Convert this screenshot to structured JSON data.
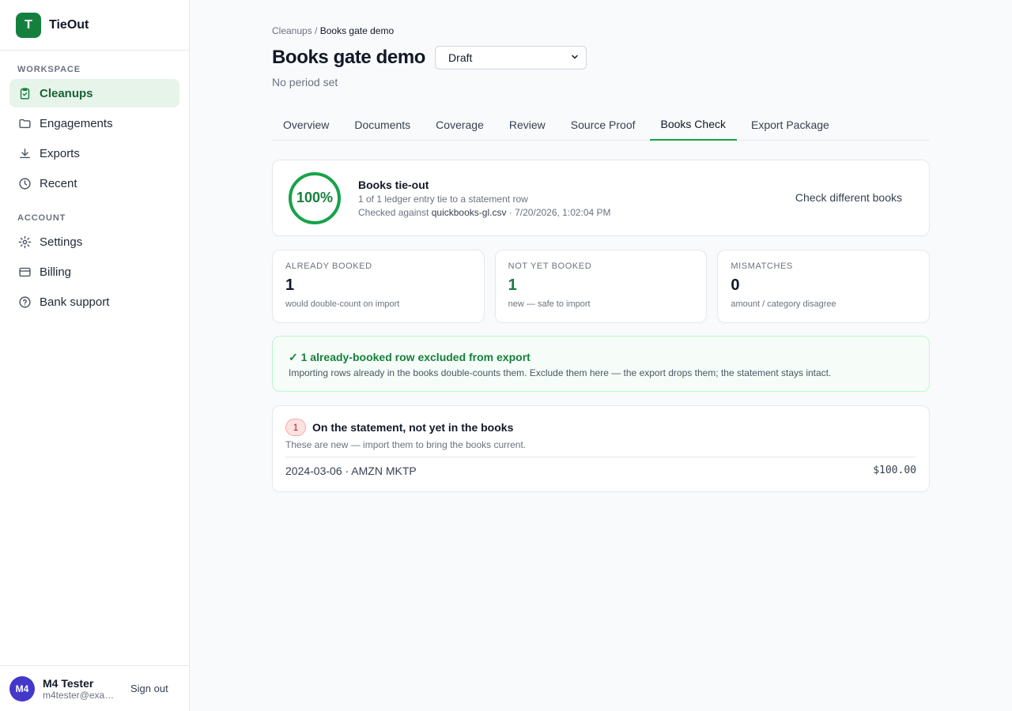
{
  "app": {
    "logo_letter": "T",
    "name": "TieOut"
  },
  "sidebar": {
    "workspace_label": "WORKSPACE",
    "account_label": "ACCOUNT",
    "workspace_items": [
      {
        "label": "Cleanups",
        "icon": "clipboard-check-icon"
      },
      {
        "label": "Engagements",
        "icon": "folder-icon"
      },
      {
        "label": "Exports",
        "icon": "download-icon"
      },
      {
        "label": "Recent",
        "icon": "clock-icon"
      }
    ],
    "account_items": [
      {
        "label": "Settings",
        "icon": "gear-icon"
      },
      {
        "label": "Billing",
        "icon": "credit-card-icon"
      },
      {
        "label": "Bank support",
        "icon": "help-circle-icon"
      }
    ]
  },
  "user": {
    "initials": "M4",
    "name": "M4 Tester",
    "email": "m4tester@example.com",
    "signout_label": "Sign out"
  },
  "breadcrumb": {
    "parent": "Cleanups",
    "separator": "/",
    "current": "Books gate demo"
  },
  "page": {
    "title": "Books gate demo",
    "status": "Draft",
    "period": "No period set"
  },
  "tabs": [
    "Overview",
    "Documents",
    "Coverage",
    "Review",
    "Source Proof",
    "Books Check",
    "Export Package"
  ],
  "active_tab": "Books Check",
  "tieout": {
    "percent": "100%",
    "title": "Books tie-out",
    "summary": "1 of 1 ledger entry tie to a statement row",
    "checked_prefix": "Checked against",
    "file": "quickbooks-gl.csv",
    "checked_suffix": "· 7/20/2026, 1:02:04 PM",
    "action_label": "Check different books"
  },
  "stats": [
    {
      "label": "ALREADY BOOKED",
      "value": "1",
      "note": "would double-count on import"
    },
    {
      "label": "NOT YET BOOKED",
      "value": "1",
      "note": "new — safe to import"
    },
    {
      "label": "MISMATCHES",
      "value": "0",
      "note": "amount / category disagree"
    }
  ],
  "banner": {
    "title": "✓ 1 already-booked row excluded from export",
    "text": "Importing rows already in the books double-counts them. Exclude them here — the export drops them; the statement stays intact."
  },
  "unbooked": {
    "count": "1",
    "title": "On the statement, not yet in the books",
    "subtitle": "These are new — import them to bring the books current.",
    "rows": [
      {
        "description": "2024-03-06 · AMZN MKTP",
        "amount": "$100.00"
      }
    ]
  },
  "colors": {
    "brand": "#15803d",
    "accent_ring": "#16a34a",
    "avatar": "#4338ca",
    "badge_red": "#b91c1c"
  }
}
